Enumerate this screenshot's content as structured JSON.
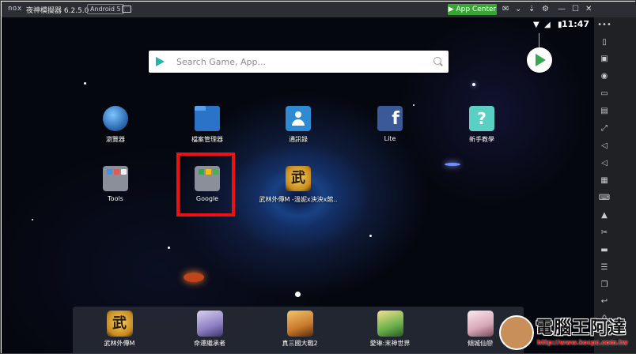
{
  "titlebar": {
    "logo": "nox",
    "title": "夜神模擬器 6.2.5.0",
    "android_badge": "Android 5",
    "app_center": "App Center"
  },
  "status": {
    "time": "11:47"
  },
  "search": {
    "placeholder": "Search Game, App..."
  },
  "apps": [
    {
      "label": "瀏覽器",
      "icon": "globe-icon",
      "color": "#2f6fb5"
    },
    {
      "label": "檔案管理器",
      "icon": "folder-icon",
      "color": "#2b73c9"
    },
    {
      "label": "通訊錄",
      "icon": "contacts-icon",
      "color": "#2f8ad4"
    },
    {
      "label": "Lite",
      "icon": "facebook-icon",
      "color": "#3b5998"
    },
    {
      "label": "新手教學",
      "icon": "tutorial-icon",
      "color": "#5ad0c4"
    },
    {
      "label": "Tools",
      "icon": "folder-tools-icon",
      "color": "#8a8f9a"
    },
    {
      "label": "Google",
      "icon": "folder-google-icon",
      "color": "#8a8f9a"
    },
    {
      "label": "武林外傳M -溫妮x泱泱x館..",
      "icon": "game-wulin-icon",
      "color": "#d9a92a"
    }
  ],
  "dock": [
    {
      "label": "武林外傳M",
      "icon": "game-wulin-icon",
      "color": "#d9a92a"
    },
    {
      "label": "命運繼承者",
      "icon": "game-heir-icon",
      "color": "#8d7fc2"
    },
    {
      "label": "真三國大戰2",
      "icon": "game-sanguo-icon",
      "color": "#c7792c"
    },
    {
      "label": "愛琳:末神世界",
      "icon": "game-eileen-icon",
      "color": "#6ab04c"
    },
    {
      "label": "傾城仙戀",
      "icon": "game-xian-icon",
      "color": "#d7a6b6"
    }
  ],
  "watermark": {
    "text": "電腦王阿達",
    "url": "http://www.kocpc.com.tw"
  },
  "colors": {
    "app_center": "#39a534",
    "highlight": "#ee1111",
    "titlebar": "#2b2e33",
    "sidebar": "#1f2125"
  }
}
